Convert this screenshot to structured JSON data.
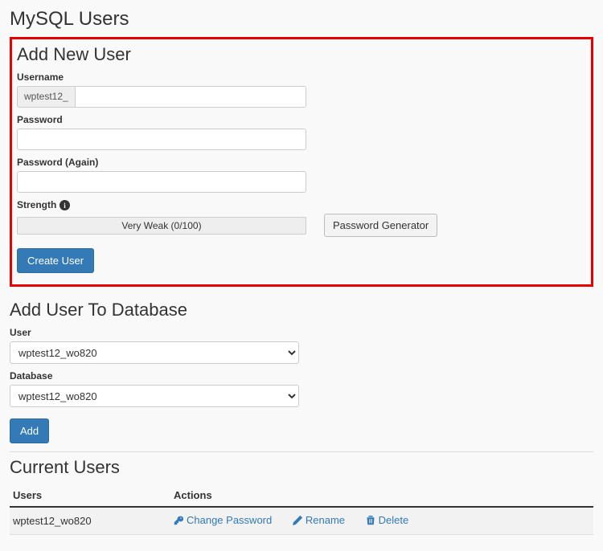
{
  "page": {
    "title": "MySQL Users"
  },
  "addUser": {
    "title": "Add New User",
    "usernameLabel": "Username",
    "usernamePrefix": "wptest12_",
    "usernameValue": "",
    "passwordLabel": "Password",
    "passwordValue": "",
    "passwordAgainLabel": "Password (Again)",
    "passwordAgainValue": "",
    "strengthLabel": "Strength",
    "strengthText": "Very Weak (0/100)",
    "passwordGeneratorLabel": "Password Generator",
    "createButton": "Create User"
  },
  "addToDb": {
    "title": "Add User To Database",
    "userLabel": "User",
    "userSelected": "wptest12_wo820",
    "databaseLabel": "Database",
    "databaseSelected": "wptest12_wo820",
    "addButton": "Add"
  },
  "currentUsers": {
    "title": "Current Users",
    "colUsers": "Users",
    "colActions": "Actions",
    "rows": [
      {
        "username": "wptest12_wo820",
        "changePassword": "Change Password",
        "rename": "Rename",
        "delete": "Delete"
      }
    ]
  }
}
